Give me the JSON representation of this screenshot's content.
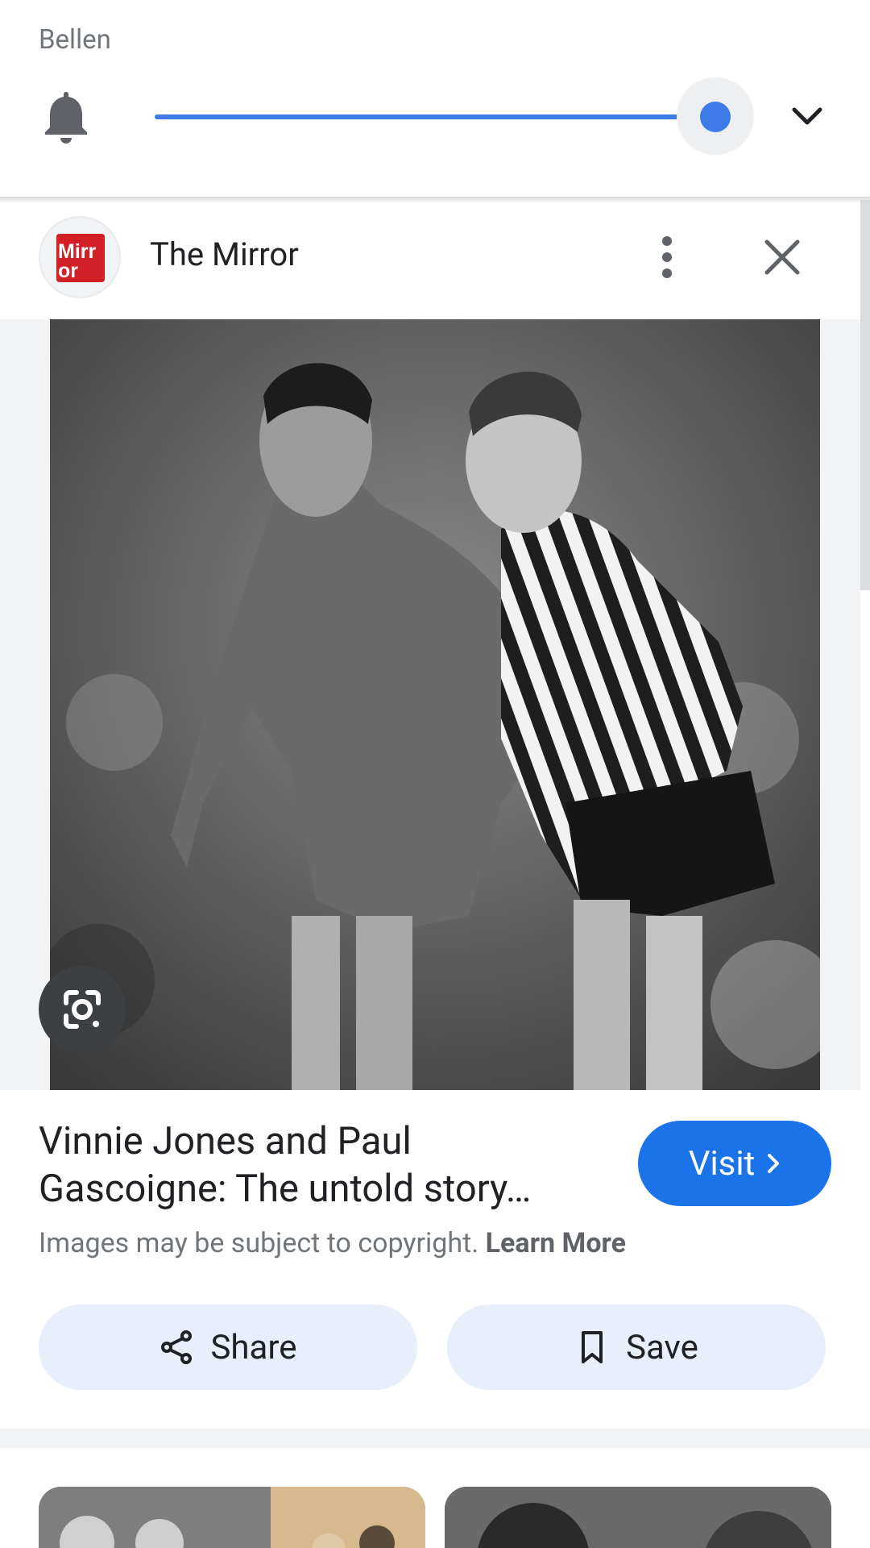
{
  "volume_panel": {
    "label": "Bellen",
    "level_percent": 100,
    "icon": "bell-icon",
    "expand_icon": "chevron-down-icon"
  },
  "source": {
    "name": "The Mirror",
    "logo_text_line1": "Mirr",
    "logo_text_line2": "or",
    "menu_icon": "more-vert-icon",
    "close_icon": "close-icon"
  },
  "image": {
    "lens_icon": "google-lens-icon"
  },
  "result": {
    "title": "Vinnie Jones and Paul Gascoigne: The untold story…",
    "visit_label": "Visit",
    "copyright_text": "Images may be subject to copyright.",
    "learn_more_label": "Learn More"
  },
  "actions": {
    "share_label": "Share",
    "save_label": "Save"
  },
  "colors": {
    "accent_blue": "#1a73e8",
    "slider_blue": "#3d7be8",
    "mirror_red": "#d32027",
    "action_button_bg": "#e8eefa"
  }
}
